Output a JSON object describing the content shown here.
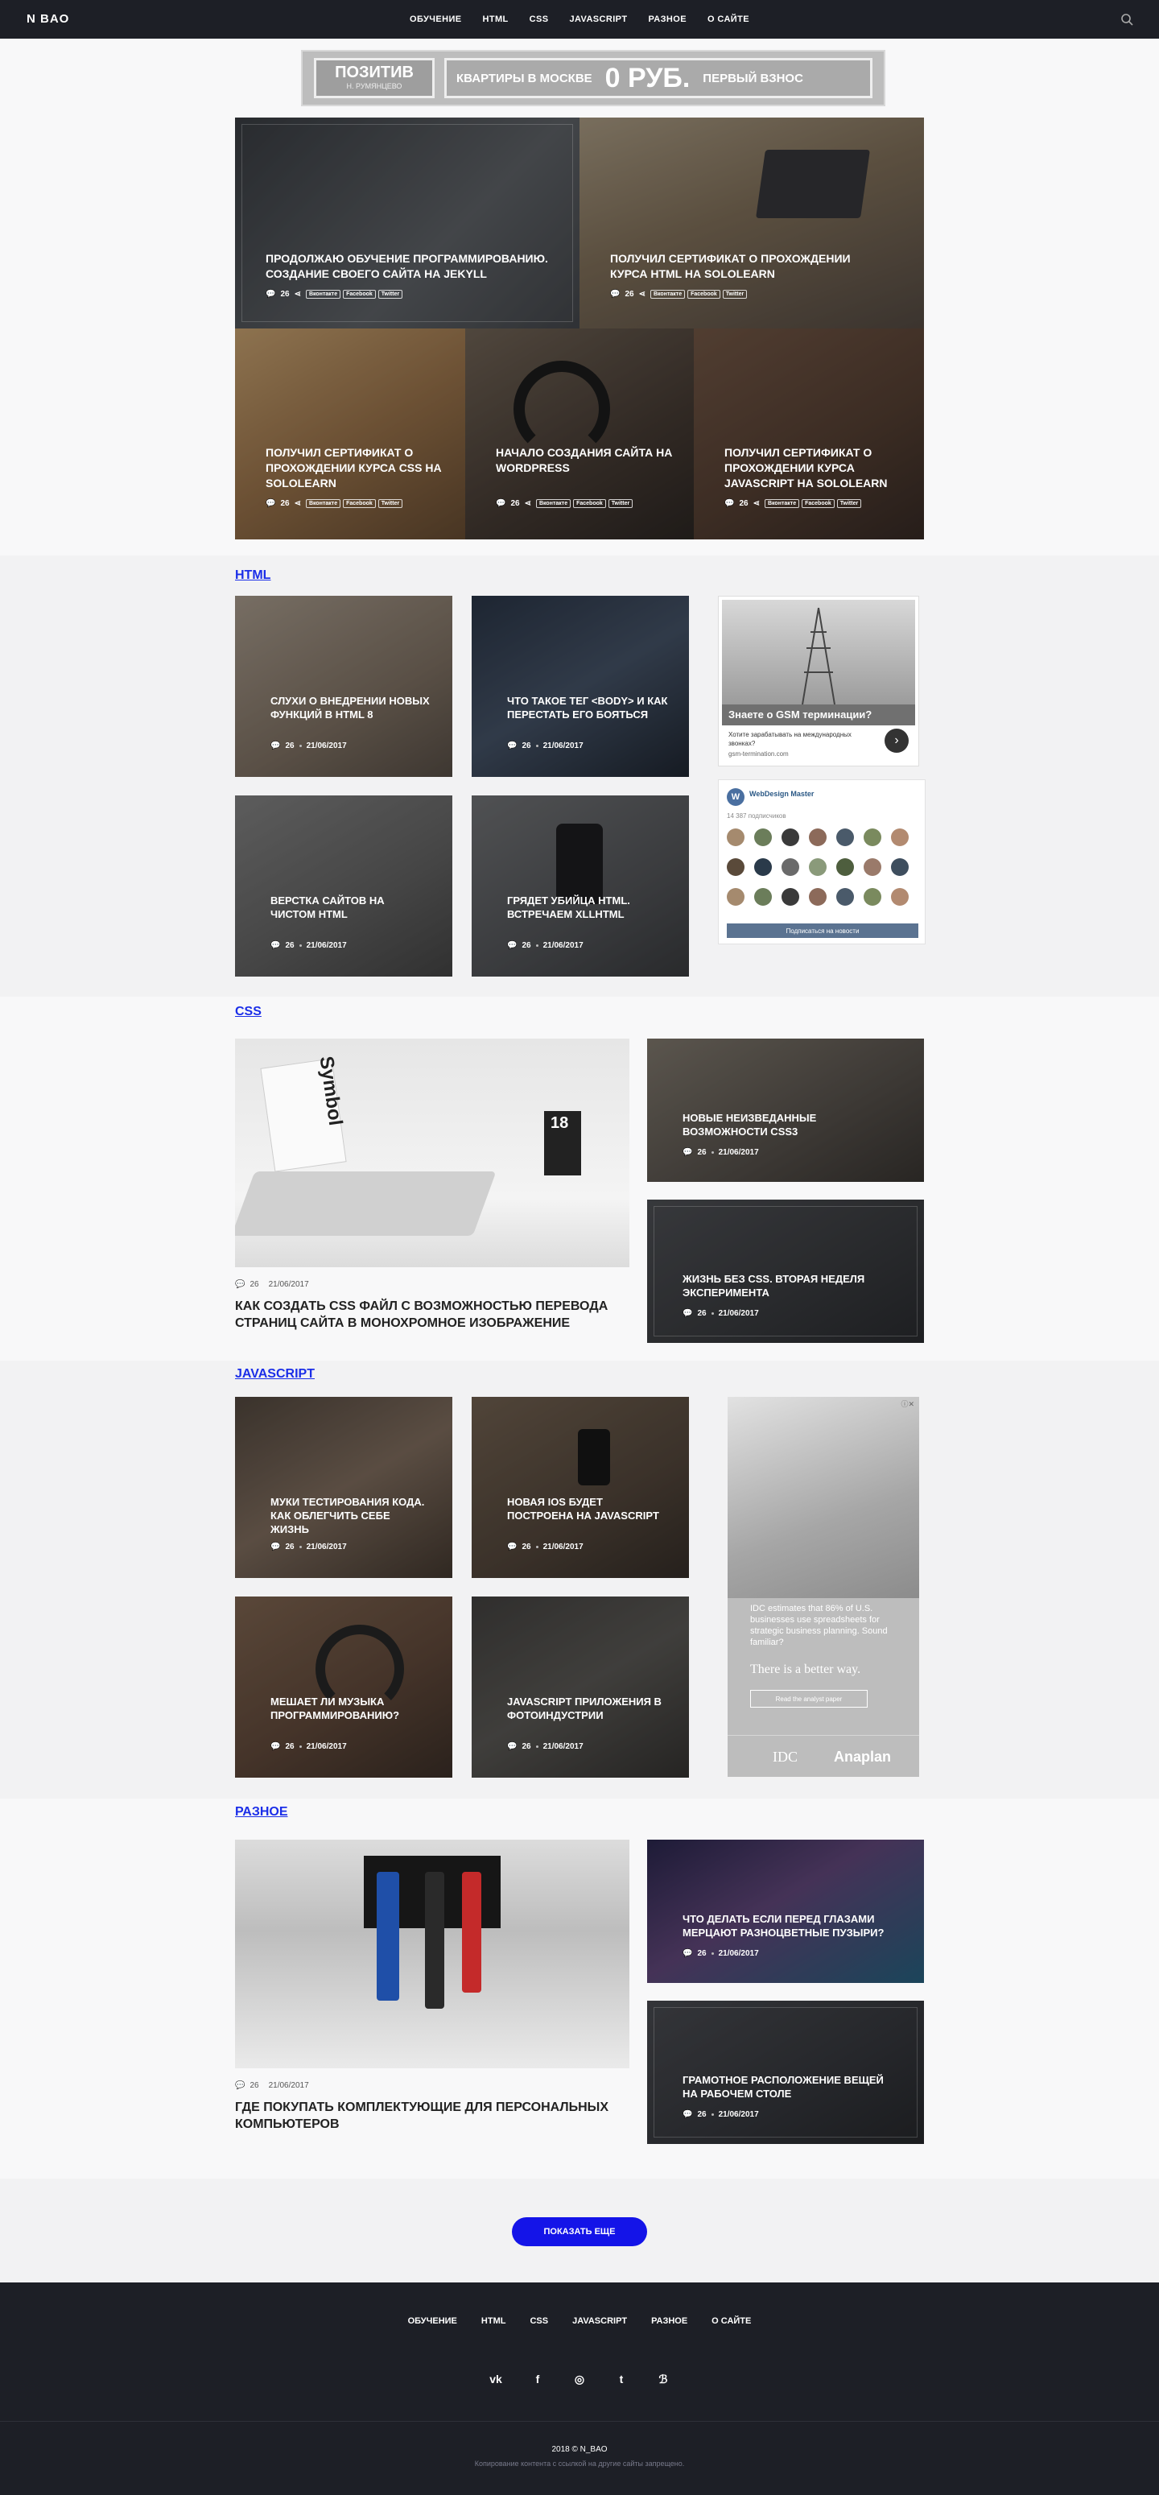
{
  "header": {
    "logo": "N BAO",
    "nav": [
      "ОБУЧЕНИЕ",
      "HTML",
      "CSS",
      "JAVASCRIPT",
      "РАЗНОЕ",
      "О САЙТЕ"
    ]
  },
  "banner": {
    "brand": "ПОЗИТИВ",
    "sub": "Н. РУМЯНЦЕВО",
    "a": "КВАРТИРЫ В МОСКВЕ",
    "b": "0 РУБ.",
    "c": "ПЕРВЫЙ ВЗНОС"
  },
  "share": {
    "vk": "Вконтакте",
    "fb": "Facebook",
    "tw": "Twitter"
  },
  "hero": [
    {
      "title": "ПРОДОЛЖАЮ ОБУЧЕНИЕ ПРОГРАММИРОВАНИЮ. СОЗДАНИЕ СВОЕГО САЙТА НА JEKYLL",
      "count": "26",
      "color": "#555a61"
    },
    {
      "title": "ПОЛУЧИЛ СЕРТИФИКАТ О ПРОХОЖДЕНИИ КУРСА HTML НА SOLOLEARN",
      "count": "26",
      "color": "#7a6e5e"
    },
    {
      "title": "ПОЛУЧИЛ СЕРТИФИКАТ О ПРОХОЖДЕНИИ КУРСА CSS НА SOLOLEARN",
      "count": "26",
      "color": "#9e7e57"
    },
    {
      "title": "НАЧАЛО СОЗДАНИЯ САЙТА НА WORDPRESS",
      "count": "26",
      "color": "#5e5148"
    },
    {
      "title": "ПОЛУЧИЛ СЕРТИФИКАТ О ПРОХОЖДЕНИИ КУРСА JAVASCRIPT НА SOLOLEARN",
      "count": "26",
      "color": "#6a5648"
    }
  ],
  "html_section": {
    "title": "HTML",
    "cards": [
      {
        "title": "СЛУХИ О ВНЕДРЕНИИ НОВЫХ ФУНКЦИЙ В HTML 8",
        "count": "26",
        "date": "21/06/2017",
        "color": "#8c7d70"
      },
      {
        "title": "ЧТО ТАКОЕ ТЕГ <BODY> И КАК ПЕРЕСТАТЬ ЕГО БОЯТЬСЯ",
        "count": "26",
        "date": "21/06/2017",
        "color": "#3d4a5c"
      },
      {
        "title": "ВЕРСТКА САЙТОВ НА ЧИСТОМ HTML",
        "count": "26",
        "date": "21/06/2017",
        "color": "#6b6b6b"
      },
      {
        "title": "ГРЯДЕТ УБИЙЦА HTML. ВСТРЕЧАЕМ XLLHTML",
        "count": "26",
        "date": "21/06/2017",
        "color": "#5d5f62"
      }
    ]
  },
  "gsm_ad": {
    "title": "Знаете о GSM терминации?",
    "text": "Хотите зарабатывать на международных звонках?",
    "url": "gsm-termination.com"
  },
  "vk_widget": {
    "name": "WebDesign Master",
    "subs": "14 387 подписчиков",
    "button": "Подписаться на новости"
  },
  "css_section": {
    "title": "CSS",
    "big": {
      "title": "КАК СОЗДАТЬ CSS ФАЙЛ С ВОЗМОЖНОСТЬЮ ПЕРЕВОДА СТРАНИЦ САЙТА В МОНОХРОМНОЕ ИЗОБРАЖЕНИЕ",
      "count": "26",
      "date": "21/06/2017",
      "book": "Symbol",
      "num": "18"
    },
    "cards": [
      {
        "title": "НОВЫЕ НЕИЗВЕДАННЫЕ ВОЗМОЖНОСТИ CSS3",
        "count": "26",
        "date": "21/06/2017",
        "color": "#6e6a64"
      },
      {
        "title": "ЖИЗНЬ БЕЗ CSS. ВТОРАЯ НЕДЕЛЯ ЭКСПЕРИМЕНТА",
        "count": "26",
        "date": "21/06/2017",
        "color": "#4c4d52"
      }
    ]
  },
  "js_section": {
    "title": "JAVASCRIPT",
    "cards": [
      {
        "title": "МУКИ ТЕСТИРОВАНИЯ КОДА. КАК ОБЛЕГЧИТЬ СЕБЕ ЖИЗНЬ",
        "count": "26",
        "date": "21/06/2017",
        "color": "#6e5c4e"
      },
      {
        "title": "НОВАЯ IOS БУДЕТ ПОСТРОЕНА НА JAVASCRIPT",
        "count": "26",
        "date": "21/06/2017",
        "color": "#6a5a4c"
      },
      {
        "title": "МЕШАЕТ ЛИ МУЗЫКА ПРОГРАММИРОВАНИЮ?",
        "count": "26",
        "date": "21/06/2017",
        "color": "#73594a"
      },
      {
        "title": "JAVASCRIPT ПРИЛОЖЕНИЯ В ФОТОИНДУСТРИИ",
        "count": "26",
        "date": "21/06/2017",
        "color": "#545250"
      }
    ]
  },
  "anaplan_ad": {
    "text": "IDC estimates that 86% of U.S. businesses use spreadsheets for strategic business planning. Sound familiar?",
    "headline": "There is a better way.",
    "button": "Read the analyst paper",
    "l1": "IDC",
    "l2": "Anaplan"
  },
  "misc_section": {
    "title": "РАЗНОЕ",
    "big": {
      "title": "ГДЕ ПОКУПАТЬ КОМПЛЕКТУЮЩИЕ ДЛЯ ПЕРСОНАЛЬНЫХ КОМПЬЮТЕРОВ",
      "count": "26",
      "date": "21/06/2017"
    },
    "cards": [
      {
        "title": "ЧТО ДЕЛАТЬ ЕСЛИ ПЕРЕД ГЛАЗАМИ МЕРЦАЮТ РАЗНОЦВЕТНЫЕ ПУЗЫРИ?",
        "count": "26",
        "date": "21/06/2017",
        "color": "#4b3f6b"
      },
      {
        "title": "ГРАМОТНОЕ РАСПОЛОЖЕНИЕ ВЕЩЕЙ НА РАБОЧЕМ СТОЛЕ",
        "count": "26",
        "date": "21/06/2017",
        "color": "#3e4046"
      }
    ]
  },
  "more_button": "ПОКАЗАТЬ ЕЩЕ",
  "footer": {
    "nav": [
      "ОБУЧЕНИЕ",
      "HTML",
      "CSS",
      "JAVASCRIPT",
      "РАЗНОЕ",
      "О САЙТЕ"
    ],
    "social": [
      "vk",
      "f",
      "◎",
      "t",
      "ℬ"
    ],
    "copy": "2018 © N_BAO",
    "note": "Копирование контента с ссылкой на другие сайты запрещено."
  }
}
